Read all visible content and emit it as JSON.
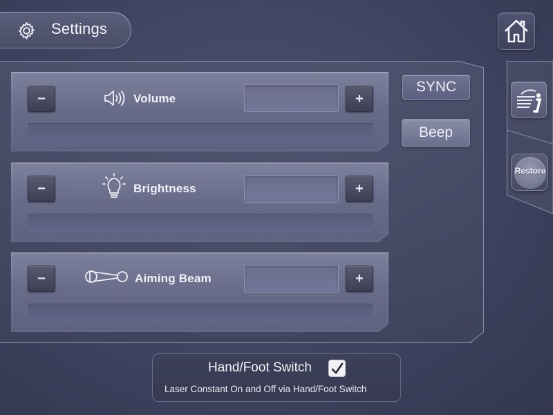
{
  "header": {
    "title": "Settings",
    "icon": "gear-icon"
  },
  "home": {
    "icon": "home-icon"
  },
  "cards": [
    {
      "label": "Volume",
      "icon": "speaker-icon",
      "minus": "−",
      "plus": "+",
      "value": ""
    },
    {
      "label": "Brightness",
      "icon": "lightbulb-icon",
      "minus": "−",
      "plus": "+",
      "value": ""
    },
    {
      "label": "Aiming Beam",
      "icon": "aiming-beam-icon",
      "minus": "−",
      "plus": "+",
      "value": ""
    }
  ],
  "side_buttons": {
    "sync": "SYNC",
    "beep": "Beep"
  },
  "right_panel": {
    "info_icon": "info-icon",
    "restore": "Restore"
  },
  "switch": {
    "title": "Hand/Foot Switch",
    "checked": true,
    "description": "Laser Constant On  and Off via Hand/Foot Switch"
  },
  "colors": {
    "background": "#3f4360",
    "card": "#6f7290",
    "button": "#474a5f"
  }
}
